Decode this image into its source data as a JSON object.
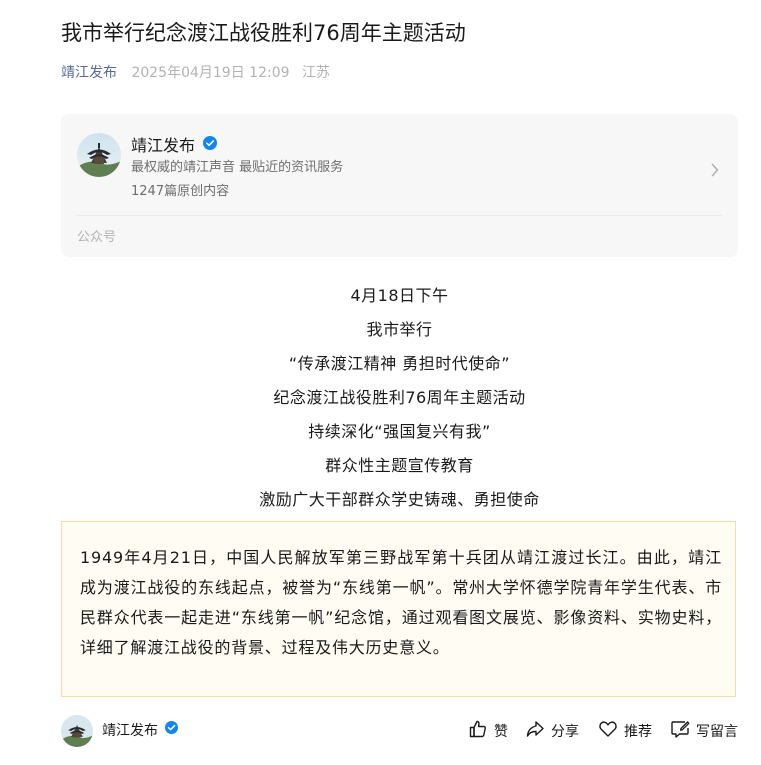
{
  "article": {
    "title": "我市举行纪念渡江战役胜利76周年主题活动",
    "source": "靖江发布",
    "datetime": "2025年04月19日 12:09",
    "location": "江苏"
  },
  "account_card": {
    "name": "靖江发布",
    "slogan": "最权威的靖江声音 最贴近的资讯服务",
    "original_count": "1247篇原创内容",
    "type_label": "公众号",
    "verified_color": "#1485ee"
  },
  "poem_lines": [
    "4月18日下午",
    "我市举行",
    "“传承渡江精神 勇担时代使命”",
    "纪念渡江战役胜利76周年主题活动",
    "持续深化“强国复兴有我”",
    "群众性主题宣传教育",
    "激励广大干部群众学史铸魂、勇担使命"
  ],
  "highlight_paragraph": "1949年4月21日，中国人民解放军第三野战军第十兵团从靖江渡过长江。由此，靖江成为渡江战役的东线起点，被誉为“东线第一帆”。常州大学怀德学院青年学生代表、市民群众代表一起走进“东线第一帆”纪念馆，通过观看图文展览、影像资料、实物史料，详细了解渡江战役的背景、过程及伟大历史意义。",
  "bottom_bar": {
    "account_name": "靖江发布",
    "actions": {
      "like": "赞",
      "share": "分享",
      "recommend": "推荐",
      "comment": "写留言"
    }
  },
  "icons": {
    "verified": "verified-check-icon",
    "chevron": "chevron-right-icon",
    "like": "thumbs-up-icon",
    "share": "share-arrow-icon",
    "recommend": "heart-icon",
    "comment": "comment-edit-icon"
  },
  "colors": {
    "link_blue": "#576b95",
    "muted": "#b2b2b2",
    "card_bg": "#f7f7f7",
    "box_bg": "#fffcf4",
    "box_border": "#f5dca8"
  }
}
